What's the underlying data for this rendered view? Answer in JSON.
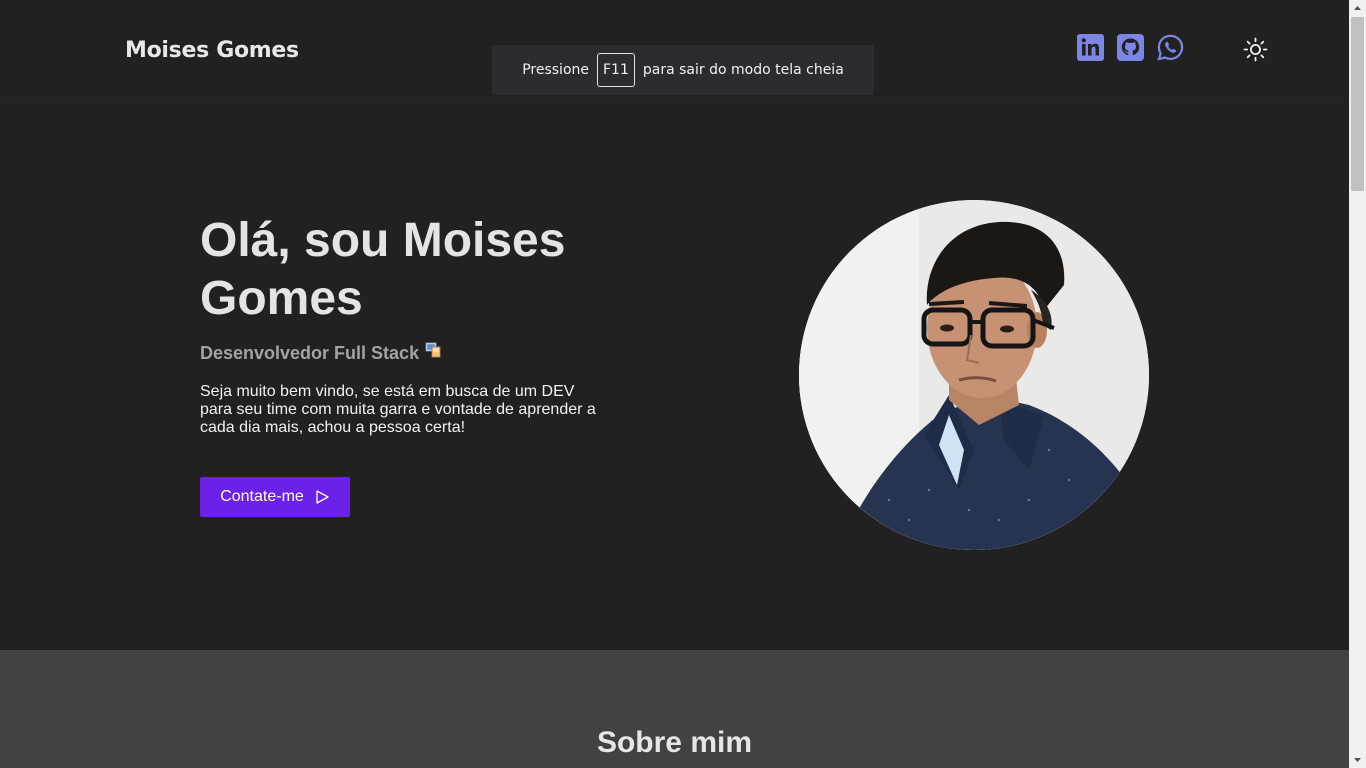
{
  "header": {
    "brand": "Moises Gomes",
    "socials": [
      {
        "name": "linkedin-icon",
        "color": "#7b86e6"
      },
      {
        "name": "github-icon",
        "color": "#7b86e6"
      },
      {
        "name": "whatsapp-icon",
        "color": "#7b86e6"
      }
    ],
    "theme_icon": "sun-icon"
  },
  "toast": {
    "prefix": "Pressione",
    "key": "F11",
    "suffix": "para sair do modo tela cheia"
  },
  "hero": {
    "title": "Olá, sou Moises Gomes",
    "subtitle": "Desenvolvedor Full Stack",
    "text": "Seja muito bem vindo, se está em busca de um DEV para seu time com muita garra e vontade de aprender a cada dia mais, achou a pessoa certa!",
    "cta_label": "Contate-me",
    "cta_color": "#6b21e8"
  },
  "about": {
    "title": "Sobre mim"
  },
  "colors": {
    "background": "#212121",
    "accent": "#6b21e8",
    "social_icon": "#7b86e6",
    "about_bg": "#424242"
  }
}
